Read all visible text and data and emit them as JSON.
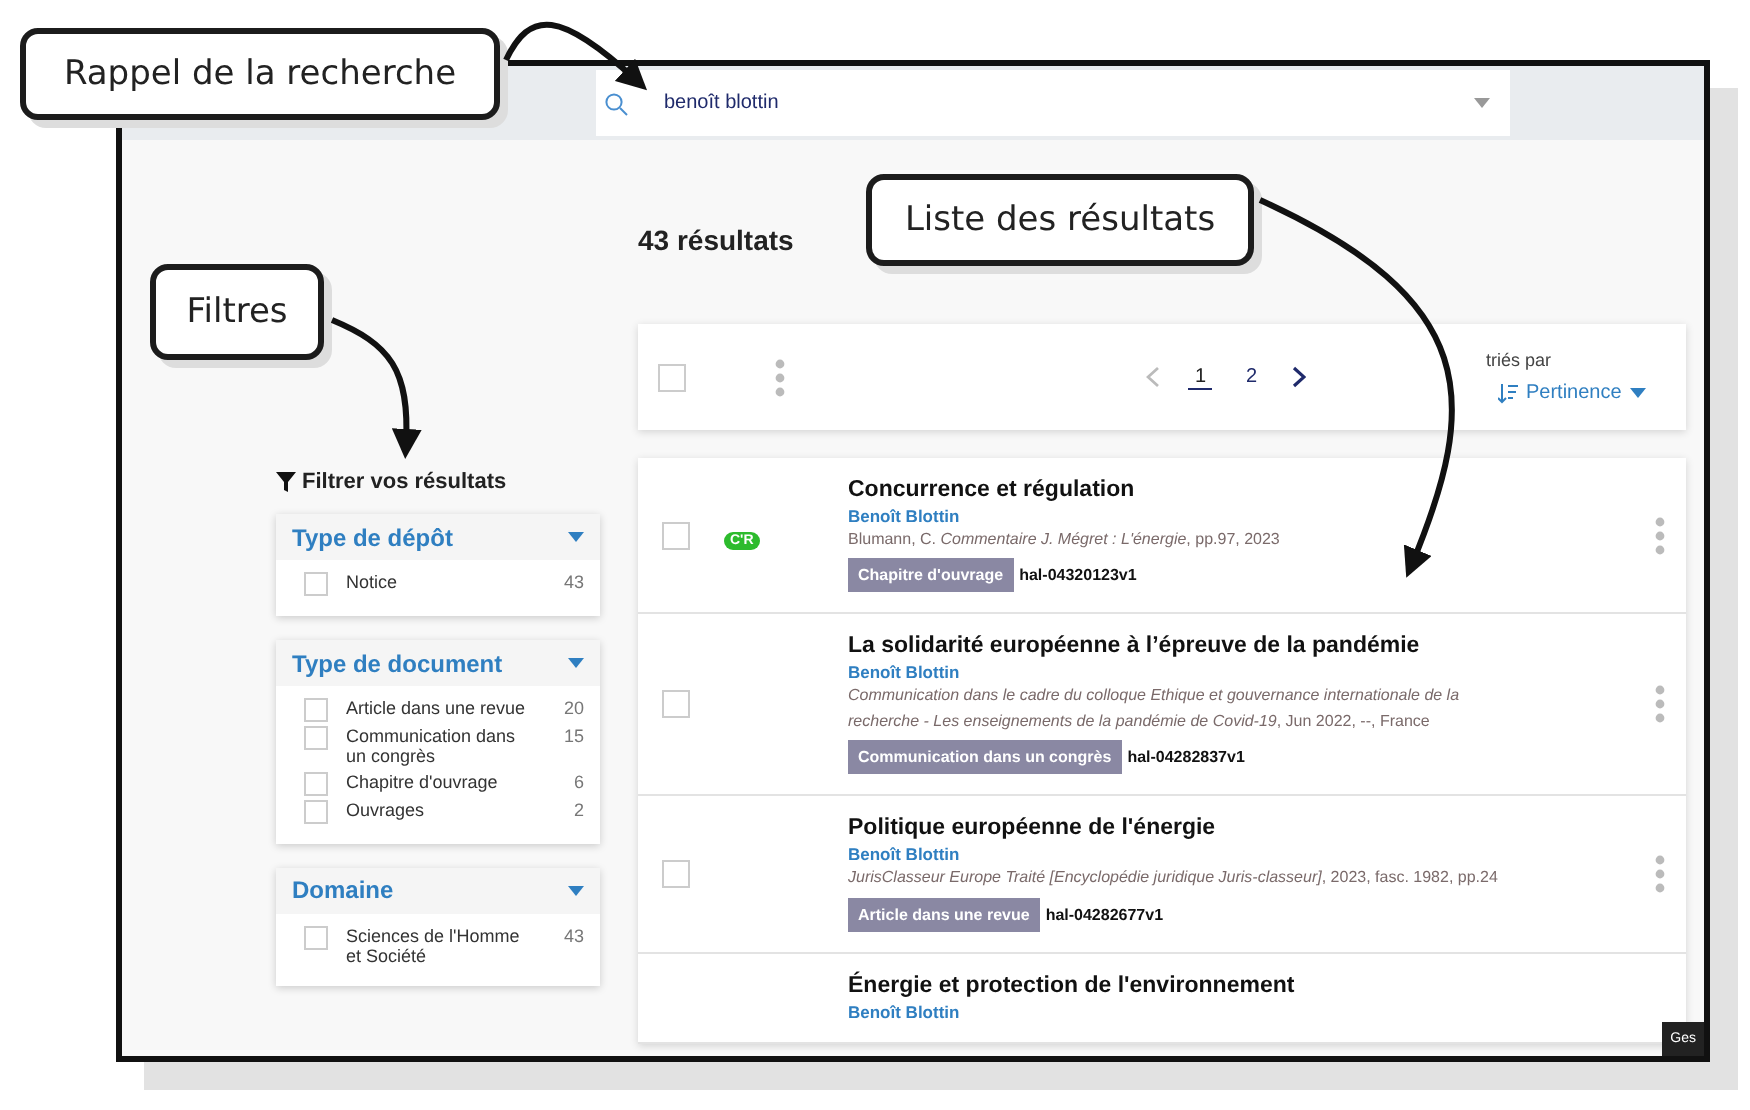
{
  "callouts": [
    {
      "label": "Rappel de la recherche"
    },
    {
      "label": "Filtres"
    },
    {
      "label": "Liste des résultats"
    }
  ],
  "search": {
    "value": "benoît blottin"
  },
  "results_count": "43 résultats",
  "toolbar": {
    "select_all_checked": false,
    "pages": [
      {
        "label": "1",
        "selected": true
      },
      {
        "label": "2",
        "selected": false
      }
    ],
    "sort_label": "triés par",
    "sort_value": "Pertinence"
  },
  "filters": {
    "title": "Filtrer vos résultats",
    "groups": [
      {
        "title": "Type de dépôt",
        "expanded": true,
        "options": [
          {
            "label": "Notice",
            "count": "43",
            "checked": false
          }
        ]
      },
      {
        "title": "Type de document",
        "expanded": true,
        "options": [
          {
            "label": "Article dans une revue",
            "count": "20",
            "checked": false
          },
          {
            "label": "Communication dans un congrès",
            "count": "15",
            "checked": false
          },
          {
            "label": "Chapitre d'ouvrage",
            "count": "6",
            "checked": false
          },
          {
            "label": "Ouvrages",
            "count": "2",
            "checked": false
          }
        ]
      },
      {
        "title": "Domaine",
        "expanded": true,
        "options": [
          {
            "label": "Sciences de l'Homme et Société",
            "count": "43",
            "checked": false
          }
        ]
      }
    ]
  },
  "results": [
    {
      "checked": false,
      "badge": "C'R",
      "title": "Concurrence et régulation",
      "author": "Benoît Blottin",
      "citation": "Blumann, C. *Commentaire J. Mégret : L'énergie*, pp.97, 2023",
      "type": "Chapitre d'ouvrage",
      "id": "hal-04320123v1"
    },
    {
      "checked": false,
      "title": "La solidarité européenne à l’épreuve de la pandémie",
      "author": "Benoît Blottin",
      "citation": "*Communication dans le cadre du colloque Ethique et gouvernance internationale de la recherche - Les enseignements de la pandémie de Covid-19*, Jun 2022, --, France",
      "type": "Communication dans un congrès",
      "id": "hal-04282837v1"
    },
    {
      "checked": false,
      "title": "Politique européenne de l'énergie",
      "author": "Benoît Blottin",
      "citation": "*JurisClasseur Europe Traité [Encyclopédie juridique Juris-classeur]*, 2023, fasc. 1982, pp.24",
      "type": "Article dans une revue",
      "id": "hal-04282677v1"
    },
    {
      "title": "Énergie et protection de l'environnement",
      "author": "Benoît Blottin"
    }
  ],
  "corner_button": {
    "label": "Ges"
  }
}
